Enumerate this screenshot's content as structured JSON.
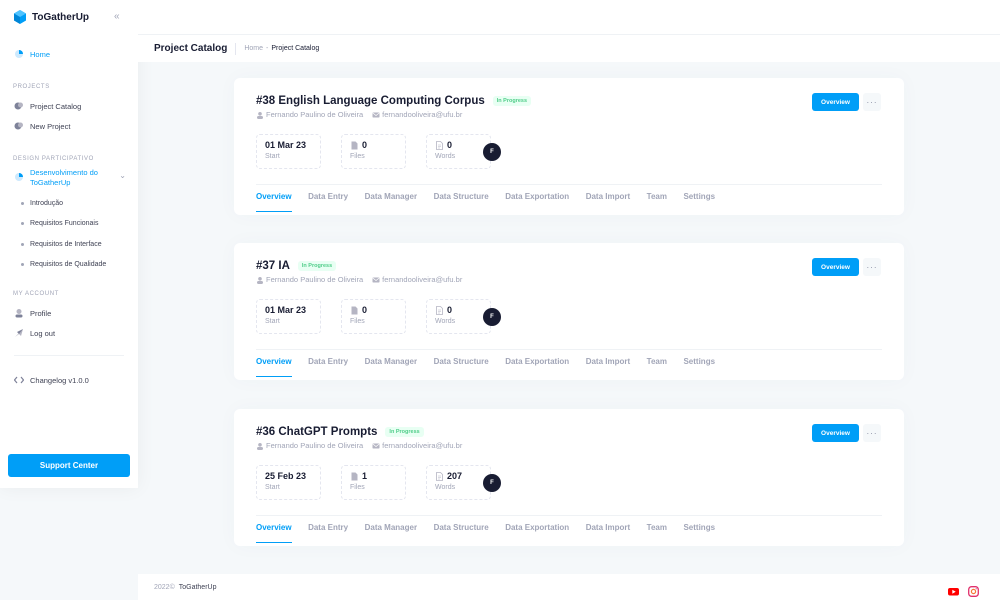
{
  "app": {
    "name": "ToGatherUp"
  },
  "sidebar": {
    "home": "Home",
    "projects_label": "PROJECTS",
    "project_catalog": "Project Catalog",
    "new_project": "New Project",
    "design_label": "DESIGN PARTICIPATIVO",
    "group_title": "Desenvolvimento do ToGatherUp",
    "subitems": [
      "Introdução",
      "Requisitos Funcionais",
      "Requisitos de Interface",
      "Requisitos de Qualidade"
    ],
    "account_label": "MY ACCOUNT",
    "profile": "Profile",
    "logout": "Log out",
    "changelog": "Changelog v1.0.0",
    "support": "Support Center"
  },
  "header": {
    "title": "Project Catalog",
    "breadcrumb": [
      "Home",
      "Project Catalog"
    ]
  },
  "projects": [
    {
      "title": "#38 English Language Computing Corpus",
      "status": "In Progress",
      "author": "Fernando Paulino de Oliveira",
      "email": "fernandooliveira@ufu.br",
      "start": "01 Mar 23",
      "start_label": "Start",
      "files": "0",
      "files_label": "Files",
      "words": "0",
      "words_label": "Words",
      "avatar": "F",
      "overview_btn": "Overview",
      "tabs": [
        "Overview",
        "Data Entry",
        "Data Manager",
        "Data Structure",
        "Data Exportation",
        "Data Import",
        "Team",
        "Settings"
      ]
    },
    {
      "title": "#37 IA",
      "status": "In Progress",
      "author": "Fernando Paulino de Oliveira",
      "email": "fernandooliveira@ufu.br",
      "start": "01 Mar 23",
      "start_label": "Start",
      "files": "0",
      "files_label": "Files",
      "words": "0",
      "words_label": "Words",
      "avatar": "F",
      "overview_btn": "Overview",
      "tabs": [
        "Overview",
        "Data Entry",
        "Data Manager",
        "Data Structure",
        "Data Exportation",
        "Data Import",
        "Team",
        "Settings"
      ]
    },
    {
      "title": "#36 ChatGPT Prompts",
      "status": "In Progress",
      "author": "Fernando Paulino de Oliveira",
      "email": "fernandooliveira@ufu.br",
      "start": "25 Feb 23",
      "start_label": "Start",
      "files": "1",
      "files_label": "Files",
      "words": "207",
      "words_label": "Words",
      "avatar": "F",
      "overview_btn": "Overview",
      "tabs": [
        "Overview",
        "Data Entry",
        "Data Manager",
        "Data Structure",
        "Data Exportation",
        "Data Import",
        "Team",
        "Settings"
      ]
    }
  ],
  "footer": {
    "year": "2022©",
    "brand": "ToGatherUp"
  },
  "colors": {
    "accent": "#009ef7",
    "success": "#50cd89",
    "dark": "#181c32",
    "muted": "#a1a5b7"
  },
  "icons": [
    "logo-icon",
    "collapse-icon",
    "home-icon",
    "catalog-icon",
    "new-project-icon",
    "design-icon",
    "chevron-down-icon",
    "profile-icon",
    "logout-icon",
    "code-icon",
    "user-icon",
    "mail-icon",
    "file-icon",
    "document-icon",
    "youtube-icon",
    "instagram-icon"
  ]
}
